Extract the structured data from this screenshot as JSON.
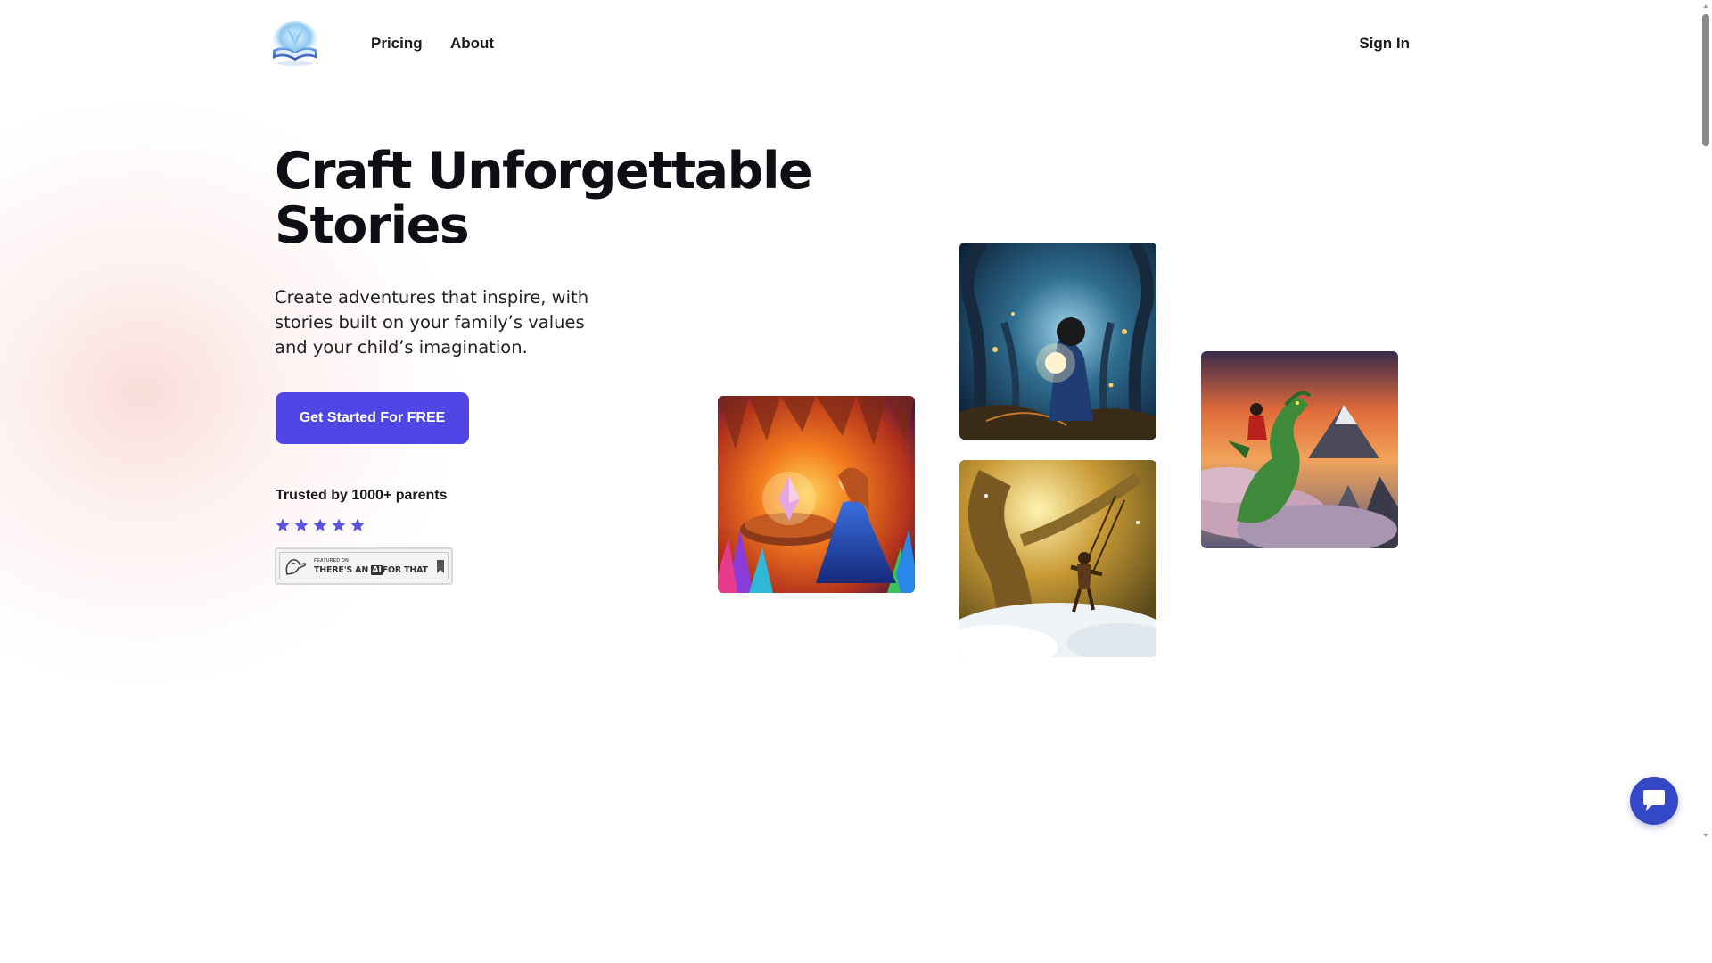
{
  "nav": {
    "logo_icon": "open-book-logo-icon",
    "links": [
      "Pricing",
      "About"
    ],
    "sign_in": "Sign In"
  },
  "hero": {
    "title_line1": "Craft Unforgettable",
    "title_line2": "Stories",
    "subtitle": "Create adventures that inspire, with stories built on your family’s values and your child’s imagination.",
    "cta": "Get Started For FREE",
    "trusted": "Trusted by 1000+ parents",
    "rating": 5,
    "rating_max": 5,
    "badge": {
      "small_text": "FEATURED ON",
      "pre": "THERE'S AN",
      "ai": "AI",
      "post": "FOR THAT"
    }
  },
  "gallery": [
    {
      "icon": "crystal-cave-princess-image"
    },
    {
      "icon": "enchanted-forest-child-image"
    },
    {
      "icon": "golden-tree-swing-image"
    },
    {
      "icon": "dragon-mountains-image"
    }
  ],
  "colors": {
    "accent": "#4f46e5",
    "chat": "#3447c7",
    "star": "#5b54e0",
    "heading": "#0e0f14"
  },
  "chat_icon": "chat-bubble-icon"
}
